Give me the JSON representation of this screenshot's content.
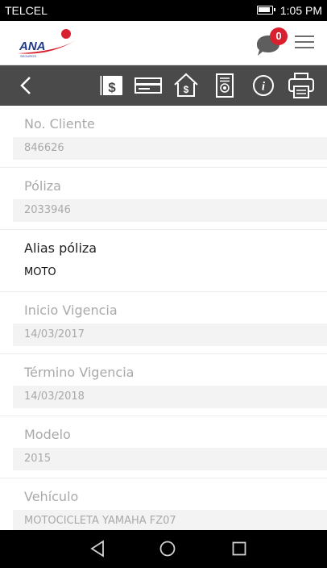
{
  "status_bar": {
    "carrier": "TELCEL",
    "time": "1:05 PM"
  },
  "header": {
    "logo_text": "ANA",
    "logo_subtext": "SEGUROS",
    "notification_count": "0",
    "brand_color": "#d8202f"
  },
  "toolbar": {
    "icons": [
      "back-icon",
      "payment-receipt-icon",
      "card-icon",
      "home-price-icon",
      "document-seal-icon",
      "info-icon",
      "print-icon"
    ]
  },
  "fields": [
    {
      "label": "No. Cliente",
      "value": "846626",
      "editable": false
    },
    {
      "label": "Póliza",
      "value": "2033946",
      "editable": false
    },
    {
      "label": "Alias póliza",
      "value": "MOTO",
      "editable": true
    },
    {
      "label": "Inicio Vigencia",
      "value": "14/03/2017",
      "editable": false
    },
    {
      "label": "Término Vigencia",
      "value": "14/03/2018",
      "editable": false
    },
    {
      "label": "Modelo",
      "value": "2015",
      "editable": false
    },
    {
      "label": "Vehículo",
      "value": "MOTOCICLETA YAMAHA FZ07",
      "editable": false
    }
  ],
  "nav": {
    "icons": [
      "back-triangle-icon",
      "home-circle-icon",
      "recents-square-icon"
    ]
  }
}
